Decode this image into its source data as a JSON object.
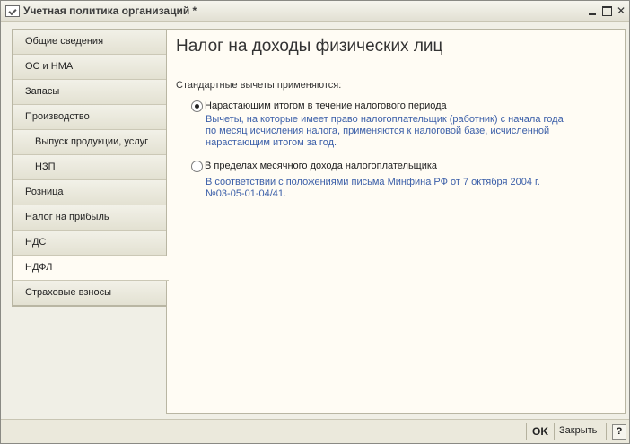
{
  "window": {
    "title": "Учетная политика организаций *",
    "icon": "app-window-icon"
  },
  "sidebar": {
    "items": [
      {
        "label": "Общие сведения",
        "sub": false,
        "active": false
      },
      {
        "label": "ОС и НМА",
        "sub": false,
        "active": false
      },
      {
        "label": "Запасы",
        "sub": false,
        "active": false
      },
      {
        "label": "Производство",
        "sub": false,
        "active": false
      },
      {
        "label": "Выпуск продукции, услуг",
        "sub": true,
        "active": false
      },
      {
        "label": "НЗП",
        "sub": true,
        "active": false
      },
      {
        "label": "Розница",
        "sub": false,
        "active": false
      },
      {
        "label": "Налог на прибыль",
        "sub": false,
        "active": false
      },
      {
        "label": "НДС",
        "sub": false,
        "active": false
      },
      {
        "label": "НДФЛ",
        "sub": false,
        "active": true
      },
      {
        "label": "Страховые взносы",
        "sub": false,
        "active": false
      }
    ]
  },
  "panel": {
    "title": "Налог на доходы физических лиц",
    "section_label": "Стандартные вычеты применяются:",
    "options": [
      {
        "label": "Нарастающим итогом в течение налогового периода",
        "checked": true,
        "description": [
          "Вычеты, на которые имеет право налогоплательщик (работник) с начала года",
          "по месяц исчисления налога, применяются к налоговой базе, исчисленной",
          "нарастающим итогом за год."
        ]
      },
      {
        "label": "В пределах месячного дохода налогоплательщика",
        "checked": false,
        "description": [
          "В соответствии с положениями письма Минфина РФ от 7 октября 2004 г.",
          "№03-05-01-04/41."
        ]
      }
    ]
  },
  "footer": {
    "ok_label": "OK",
    "close_label": "Закрыть",
    "help_label": "?"
  },
  "colors": {
    "description_text": "#3a5ea8",
    "panel_background": "#fffcf4",
    "window_background": "#f0efe6"
  }
}
